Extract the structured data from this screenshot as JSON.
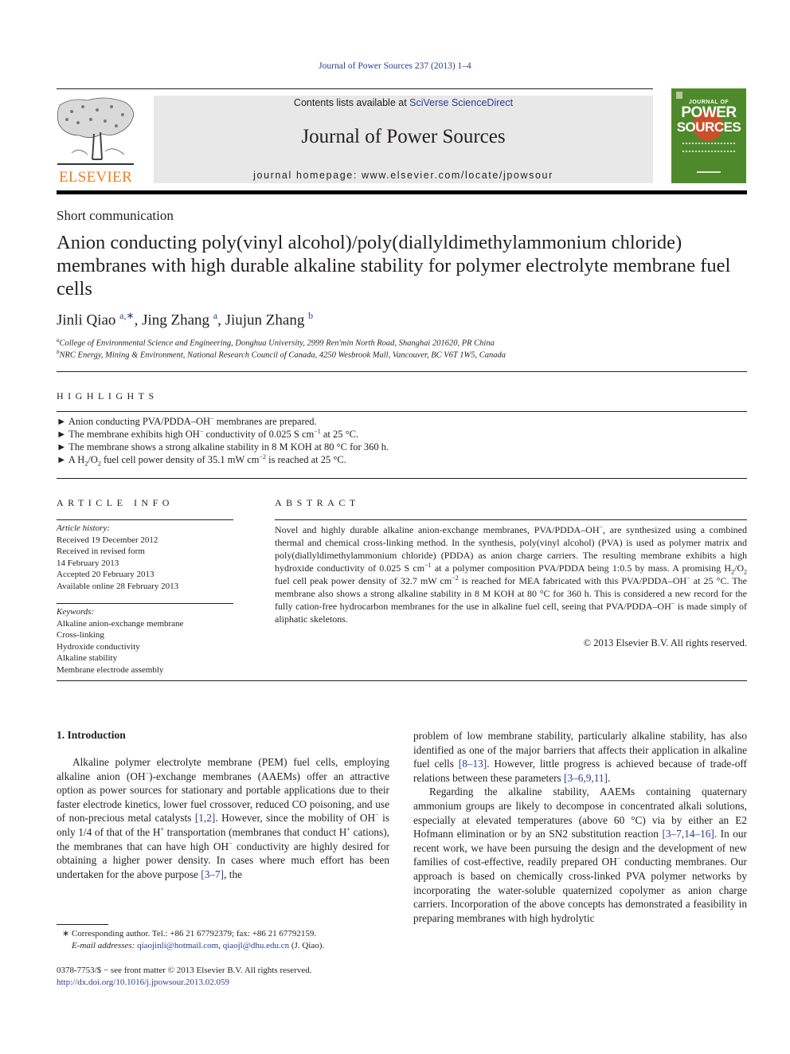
{
  "running_head": "Journal of Power Sources 237 (2013) 1–4",
  "header": {
    "publisher_logo_text": "ELSEVIER",
    "contents_prefix": "Contents lists available at ",
    "contents_link": "SciVerse ScienceDirect",
    "journal_title": "Journal of Power Sources",
    "homepage_prefix": "journal homepage: ",
    "homepage_url": "www.elsevier.com/locate/jpowsour",
    "cover": {
      "top_text": "JOURNAL OF",
      "line1": "POWER",
      "line2": "SOURCES",
      "bg_color": "#4e8a2c",
      "accent_color": "#c9502a"
    },
    "logo_color": "#f07e1b"
  },
  "article": {
    "type": "Short communication",
    "title": "Anion conducting poly(vinyl alcohol)/poly(diallyldimethylammonium chloride) membranes with high durable alkaline stability for polymer electrolyte membrane fuel cells",
    "authors": [
      {
        "name": "Jinli Qiao",
        "marks": "a,∗"
      },
      {
        "name": "Jing Zhang",
        "marks": "a"
      },
      {
        "name": "Jiujun Zhang",
        "marks": "b"
      }
    ],
    "affiliations": [
      {
        "mark": "a",
        "text": "College of Environmental Science and Engineering, Donghua University, 2999 Ren'min North Road, Shanghai 201620, PR China"
      },
      {
        "mark": "b",
        "text": "NRC Energy, Mining & Environment, National Research Council of Canada, 4250 Wesbrook Mall, Vancouver, BC V6T 1W5, Canada"
      }
    ]
  },
  "highlights": {
    "heading": "HIGHLIGHTS",
    "bullet": "►",
    "items": [
      {
        "a": "Anion conducting PVA/PDDA–OH",
        "sup1": "−",
        "b": " membranes are prepared."
      },
      {
        "a": "The membrane exhibits high OH",
        "sup1": "−",
        "b": " conductivity of 0.025 S cm",
        "sup2": "−1",
        "c": " at 25 °C."
      },
      {
        "a": "The membrane shows a strong alkaline stability in 8 M KOH at 80 °C for 360 h."
      },
      {
        "a": "A H",
        "sub1": "2",
        "b": "/O",
        "sub2": "2",
        "c": " fuel cell power density of 35.1 mW cm",
        "sup1": "−2",
        "d": " is reached at 25 °C."
      }
    ]
  },
  "article_info": {
    "heading": "ARTICLE INFO",
    "history_label": "Article history:",
    "history": [
      "Received 19 December 2012",
      "Received in revised form",
      "14 February 2013",
      "Accepted 20 February 2013",
      "Available online 28 February 2013"
    ],
    "keywords_label": "Keywords:",
    "keywords": [
      "Alkaline anion-exchange membrane",
      "Cross-linking",
      "Hydroxide conductivity",
      "Alkaline stability",
      "Membrane electrode assembly"
    ]
  },
  "abstract": {
    "heading": "ABSTRACT",
    "p1": "Novel and highly durable alkaline anion-exchange membranes, PVA/PDDA–OH",
    "p2": ", are synthesized using a combined thermal and chemical cross-linking method. In the synthesis, poly(vinyl alcohol) (PVA) is used as polymer matrix and poly(diallyldimethylammonium chloride) (PDDA) as anion charge carriers. The resulting membrane exhibits a high hydroxide conductivity of 0.025 S cm",
    "p3": " at a polymer composition PVA/PDDA being 1:0.5 by mass. A promising H",
    "p4": "/O",
    "p5": " fuel cell peak power density of 32.7 mW cm",
    "p6": " is reached for MEA fabricated with this PVA/PDDA–OH",
    "p7": " at 25 °C. The membrane also shows a strong alkaline stability in 8 M KOH at 80 °C for 360 h. This is considered a new record for the fully cation-free hydrocarbon membranes for the use in alkaline fuel cell, seeing that PVA/PDDA–OH",
    "p8": " is made simply of aliphatic skeletons.",
    "minus": "−",
    "minus1": "−1",
    "minus2": "−2",
    "two": "2",
    "copyright": "© 2013 Elsevier B.V. All rights reserved."
  },
  "intro": {
    "heading": "1.  Introduction",
    "left": {
      "t1": "Alkaline polymer electrolyte membrane (PEM) fuel cells, employing alkaline anion (OH",
      "t2": ")-exchange membranes (AAEMs) offer an attractive option as power sources for stationary and portable applications due to their faster electrode kinetics, lower fuel crossover, reduced CO poisoning, and use of non-precious metal catalysts ",
      "ref1": "[1,2]",
      "t3": ". However, since the mobility of OH",
      "t4": " is only 1/4 of that of the H",
      "t5": " transportation (membranes that conduct H",
      "t6": " cations), the membranes that can have high OH",
      "t7": " conductivity are highly desired for obtaining a higher power density. In cases where much effort has been undertaken for the above purpose ",
      "ref2": "[3–7]",
      "t8": ", the",
      "minus": "−",
      "plus": "+"
    },
    "right": {
      "t1": "problem of low membrane stability, particularly alkaline stability, has also identified as one of the major barriers that affects their application in alkaline fuel cells ",
      "ref1": "[8–13]",
      "t2": ". However, little progress is achieved because of trade-off relations between these parameters ",
      "ref2": "[3–6,9,11]",
      "t3": ".",
      "p2a": "Regarding the alkaline stability, AAEMs containing quaternary ammonium groups are likely to decompose in concentrated alkali solutions, especially at elevated temperatures (above 60 °C) via by either an E2 Hofmann elimination or by an SN2 substitution reaction ",
      "ref3": "[3–7,14–16]",
      "p2b": ". In our recent work, we have been pursuing the design and the development of new families of cost-effective, readily prepared OH",
      "p2c": " conducting membranes. Our approach is based on chemically cross-linked PVA polymer networks by incorporating the water-soluble quaternized copolymer as anion charge carriers. Incorporation of the above concepts has demonstrated a feasibility in preparing membranes with high hydrolytic",
      "minus": "−"
    }
  },
  "footnotes": {
    "star": "∗",
    "corresponding": "Corresponding author. Tel.: +86 21 67792379; fax: +86 21 67792159.",
    "email_label": "E-mail addresses:",
    "email1": "qiaojinli@hotmail.com",
    "sep": ", ",
    "email2": "qiaojl@dhu.edu.cn",
    "email_owner": " (J. Qiao).",
    "issn": "0378-7753/$ − see front matter © 2013 Elsevier B.V. All rights reserved.",
    "doi": "http://dx.doi.org/10.1016/j.jpowsour.2013.02.059"
  }
}
